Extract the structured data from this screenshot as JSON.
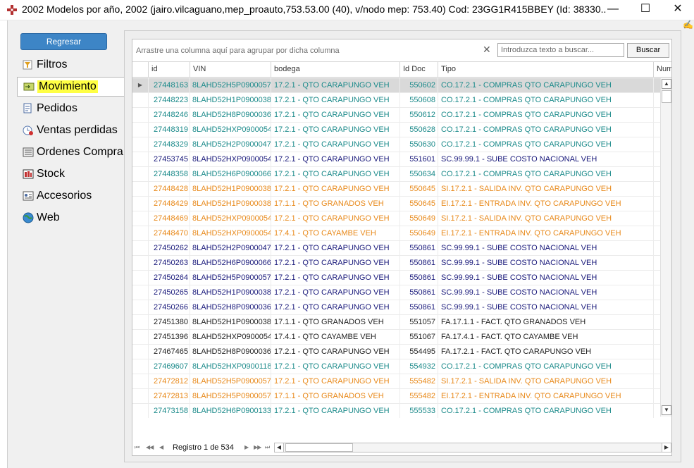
{
  "window": {
    "title": "2002 Modelos por año, 2002 (jairo.vilcaguano,mep_proauto,753.53.00 (40), v/nodo mep: 753.40) Cod: 23GG1R415BBEY (Id: 38330...",
    "minimize": "—",
    "maximize": "☐",
    "close": "✕"
  },
  "colors": {
    "teal": "#1b8a8a",
    "navy": "#18187a",
    "orange": "#e8891a",
    "black": "#222222",
    "blue_id": "#2a63c0"
  },
  "sidebar": {
    "back_label": "Regresar",
    "items": [
      {
        "label": "Filtros",
        "icon": "filter-icon"
      },
      {
        "label": "Movimiento",
        "icon": "movement-icon"
      },
      {
        "label": "Pedidos",
        "icon": "orders-icon"
      },
      {
        "label": "Ventas perdidas",
        "icon": "lost-sales-icon"
      },
      {
        "label": "Ordenes Compra",
        "icon": "purchase-orders-icon"
      },
      {
        "label": "Stock",
        "icon": "stock-icon"
      },
      {
        "label": "Accesorios",
        "icon": "accessories-icon"
      },
      {
        "label": "Web",
        "icon": "web-icon"
      }
    ]
  },
  "grid": {
    "group_hint": "Arrastre una columna aquí para agrupar por dicha columna",
    "search_placeholder": "Introduzca texto a buscar...",
    "search_button": "Buscar",
    "clear_glyph": "✕",
    "columns": [
      "id",
      "VIN",
      "bodega",
      "Id Doc",
      "Tipo",
      "Nume"
    ],
    "rows": [
      {
        "id": "27448163",
        "vin": "8LAHD52H5P0900057",
        "bodega": "17.2.1 - QTO CARAPUNGO VEH",
        "doc": "550602",
        "tipo": "CO.17.2.1 - COMPRAS QTO CARAPUNGO VEH",
        "color": "teal",
        "selected": true
      },
      {
        "id": "27448223",
        "vin": "8LAHD52H1P0900038",
        "bodega": "17.2.1 - QTO CARAPUNGO VEH",
        "doc": "550608",
        "tipo": "CO.17.2.1 - COMPRAS QTO CARAPUNGO VEH",
        "color": "teal"
      },
      {
        "id": "27448246",
        "vin": "8LAHD52H8P0900036",
        "bodega": "17.2.1 - QTO CARAPUNGO VEH",
        "doc": "550612",
        "tipo": "CO.17.2.1 - COMPRAS QTO CARAPUNGO VEH",
        "color": "teal"
      },
      {
        "id": "27448319",
        "vin": "8LAHD52HXP0900054",
        "bodega": "17.2.1 - QTO CARAPUNGO VEH",
        "doc": "550628",
        "tipo": "CO.17.2.1 - COMPRAS QTO CARAPUNGO VEH",
        "color": "teal"
      },
      {
        "id": "27448329",
        "vin": "8LAHD52H2P0900047",
        "bodega": "17.2.1 - QTO CARAPUNGO VEH",
        "doc": "550630",
        "tipo": "CO.17.2.1 - COMPRAS QTO CARAPUNGO VEH",
        "color": "teal"
      },
      {
        "id": "27453745",
        "vin": "8LAHD52HXP0900054",
        "bodega": "17.2.1 - QTO CARAPUNGO VEH",
        "doc": "551601",
        "tipo": "SC.99.99.1 - SUBE COSTO NACIONAL VEH",
        "color": "navy"
      },
      {
        "id": "27448358",
        "vin": "8LAHD52H6P0900066",
        "bodega": "17.2.1 - QTO CARAPUNGO VEH",
        "doc": "550634",
        "tipo": "CO.17.2.1 - COMPRAS QTO CARAPUNGO VEH",
        "color": "teal"
      },
      {
        "id": "27448428",
        "vin": "8LAHD52H1P0900038",
        "bodega": "17.2.1 - QTO CARAPUNGO VEH",
        "doc": "550645",
        "tipo": "SI.17.2.1 - SALIDA INV. QTO CARAPUNGO  VEH",
        "color": "orange"
      },
      {
        "id": "27448429",
        "vin": "8LAHD52H1P0900038",
        "bodega": "17.1.1 - QTO GRANADOS VEH",
        "doc": "550645",
        "tipo": "EI.17.2.1 - ENTRADA INV. QTO CARAPUNGO  VEH",
        "color": "orange"
      },
      {
        "id": "27448469",
        "vin": "8LAHD52HXP0900054",
        "bodega": "17.2.1 - QTO CARAPUNGO VEH",
        "doc": "550649",
        "tipo": "SI.17.2.1 - SALIDA INV. QTO CARAPUNGO  VEH",
        "color": "orange"
      },
      {
        "id": "27448470",
        "vin": "8LAHD52HXP0900054",
        "bodega": "17.4.1 - QTO CAYAMBE VEH",
        "doc": "550649",
        "tipo": "EI.17.2.1 - ENTRADA INV. QTO CARAPUNGO  VEH",
        "color": "orange"
      },
      {
        "id": "27450262",
        "vin": "8LAHD52H2P0900047",
        "bodega": "17.2.1 - QTO CARAPUNGO VEH",
        "doc": "550861",
        "tipo": "SC.99.99.1 - SUBE COSTO NACIONAL VEH",
        "color": "navy"
      },
      {
        "id": "27450263",
        "vin": "8LAHD52H6P0900066",
        "bodega": "17.2.1 - QTO CARAPUNGO VEH",
        "doc": "550861",
        "tipo": "SC.99.99.1 - SUBE COSTO NACIONAL VEH",
        "color": "navy"
      },
      {
        "id": "27450264",
        "vin": "8LAHD52H5P0900057",
        "bodega": "17.2.1 - QTO CARAPUNGO VEH",
        "doc": "550861",
        "tipo": "SC.99.99.1 - SUBE COSTO NACIONAL VEH",
        "color": "navy"
      },
      {
        "id": "27450265",
        "vin": "8LAHD52H1P0900038",
        "bodega": "17.2.1 - QTO CARAPUNGO VEH",
        "doc": "550861",
        "tipo": "SC.99.99.1 - SUBE COSTO NACIONAL VEH",
        "color": "navy"
      },
      {
        "id": "27450266",
        "vin": "8LAHD52H8P0900036",
        "bodega": "17.2.1 - QTO CARAPUNGO VEH",
        "doc": "550861",
        "tipo": "SC.99.99.1 - SUBE COSTO NACIONAL VEH",
        "color": "navy"
      },
      {
        "id": "27451380",
        "vin": "8LAHD52H1P0900038",
        "bodega": "17.1.1 - QTO GRANADOS VEH",
        "doc": "551057",
        "tipo": "FA.17.1.1 - FACT. QTO GRANADOS VEH",
        "color": "black"
      },
      {
        "id": "27451396",
        "vin": "8LAHD52HXP0900054",
        "bodega": "17.4.1 - QTO CAYAMBE VEH",
        "doc": "551067",
        "tipo": "FA.17.4.1 - FACT. QTO CAYAMBE VEH",
        "color": "black"
      },
      {
        "id": "27467465",
        "vin": "8LAHD52H8P0900036",
        "bodega": "17.2.1 - QTO CARAPUNGO VEH",
        "doc": "554495",
        "tipo": "FA.17.2.1 - FACT. QTO CARAPUNGO VEH",
        "color": "black"
      },
      {
        "id": "27469607",
        "vin": "8LAHD52HXP0900118",
        "bodega": "17.2.1 - QTO CARAPUNGO VEH",
        "doc": "554932",
        "tipo": "CO.17.2.1 - COMPRAS QTO CARAPUNGO VEH",
        "color": "teal"
      },
      {
        "id": "27472812",
        "vin": "8LAHD52H5P0900057",
        "bodega": "17.2.1 - QTO CARAPUNGO VEH",
        "doc": "555482",
        "tipo": "SI.17.2.1 - SALIDA INV. QTO CARAPUNGO  VEH",
        "color": "orange"
      },
      {
        "id": "27472813",
        "vin": "8LAHD52H5P0900057",
        "bodega": "17.1.1 - QTO GRANADOS VEH",
        "doc": "555482",
        "tipo": "EI.17.2.1 - ENTRADA INV. QTO CARAPUNGO  VEH",
        "color": "orange"
      },
      {
        "id": "27473158",
        "vin": "8LAHD52H6P0900133",
        "bodega": "17.2.1 - QTO CARAPUNGO VEH",
        "doc": "555533",
        "tipo": "CO.17.2.1 - COMPRAS QTO CARAPUNGO VEH",
        "color": "teal"
      }
    ],
    "pager": {
      "text": "Registro 1 de 534",
      "first": "⏮",
      "prev_page": "◀◀",
      "prev": "◀",
      "next": "▶",
      "next_page": "▶▶",
      "last": "⏭"
    }
  }
}
